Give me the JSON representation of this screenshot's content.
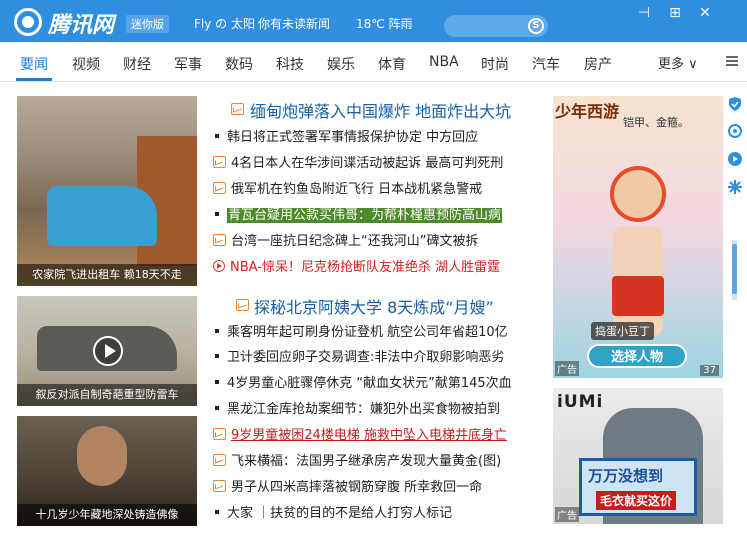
{
  "titlebar": {
    "brand": "腾讯网",
    "mini": "迷你版",
    "user": "Fly の 太阳",
    "news_alert": "你有未读新闻",
    "weather": "18℃ 阵雨",
    "search_placeholder": "",
    "search_icon_glyph": "S",
    "pin_glyph": "⊣",
    "max_glyph": "⊞",
    "close_glyph": "✕"
  },
  "nav": {
    "items": [
      "要闻",
      "视频",
      "财经",
      "军事",
      "数码",
      "科技",
      "娱乐",
      "体育",
      "NBA",
      "时尚",
      "汽车",
      "房产"
    ],
    "more": "更多 ∨",
    "active_color": "#1e7cd6"
  },
  "photos": [
    {
      "caption": "农家院飞进出租车 赖18天不走"
    },
    {
      "caption": "叙反对派自制奇葩重型防雷车"
    },
    {
      "caption": "十几岁少年藏地深处铸造佛像"
    }
  ],
  "headlines": [
    "缅甸炮弹落入中国爆炸 地面炸出大坑",
    "探秘北京阿姨大学 8天炼成“月嫂”"
  ],
  "news1": [
    {
      "text": "韩日将正式签署军事情报保护协定 中方回应",
      "icon": "dot"
    },
    {
      "text": "4名日本人在华涉间谍活动被起诉 最高可判死刑",
      "icon": "image"
    },
    {
      "text": "俄军机在钓鱼岛附近飞行 日本战机紧急警戒",
      "icon": "image"
    },
    {
      "text": "青瓦台疑用公款买伟哥：为帮朴槿惠预防高山病",
      "icon": "dot"
    },
    {
      "text": "台湾一座抗日纪念碑上“还我河山”碑文被拆",
      "icon": "image"
    },
    {
      "text": "NBA-惊呆！尼克杨抢断队友准绝杀 湖人胜雷霆",
      "icon": "play"
    }
  ],
  "news2": [
    {
      "text": "乘客明年起可刷身份证登机 航空公司年省超10亿",
      "icon": "dot"
    },
    {
      "text": "卫计委回应卵子交易调查:非法中介取卵影响恶劣",
      "icon": "dot"
    },
    {
      "text": "4岁男童心脏骤停休克 “献血女状元”献第145次血",
      "icon": "dot"
    },
    {
      "text": "黑龙江金库抢劫案细节：嫌犯外出买食物被拍到",
      "icon": "dot"
    },
    {
      "text": "9岁男童被困24楼电梯 施救中坠入电梯井底身亡",
      "icon": "image"
    },
    {
      "text": "飞来横福：法国男子继承房产发现大量黄金(图)",
      "icon": "image"
    },
    {
      "text": "男子从四米高摔落被钢筋穿腹 所幸救回一命",
      "icon": "image"
    },
    {
      "text": "大家 ｜扶贫的目的不是给人打穷人标记",
      "icon": "dot"
    }
  ],
  "ads": {
    "ad1": {
      "title": "少年西游",
      "slogan": "铠甲、金箍。",
      "tag": "捣蛋小豆丁",
      "button": "选择人物",
      "mark": "广告",
      "count": "37"
    },
    "ad2": {
      "brand": "iUMi",
      "line1": "万万没想到",
      "line2": "毛衣就买这价",
      "mark": "广告"
    }
  }
}
